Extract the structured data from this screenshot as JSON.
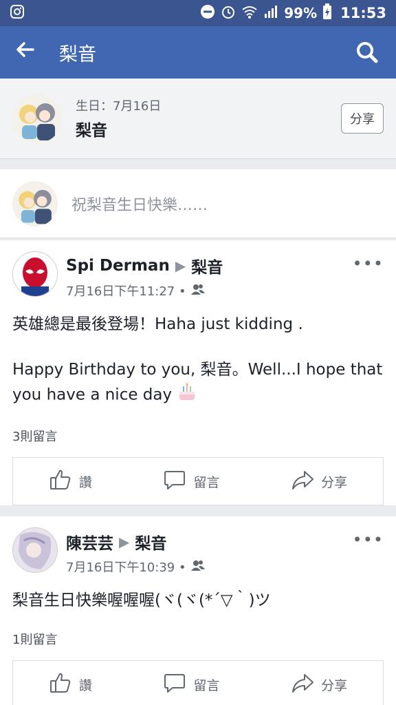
{
  "status": {
    "battery_pct": "99%",
    "time": "11:53"
  },
  "header": {
    "title": "梨音"
  },
  "profile": {
    "birthday": "生日：7月16日",
    "name": "梨音",
    "share_label": "分享"
  },
  "composer": {
    "placeholder": "祝梨音生日快樂……"
  },
  "posts": [
    {
      "author": "Spi Derman",
      "target": "梨音",
      "date": "7月16日下午11:27 •",
      "body": [
        "英雄總是最後登場！Haha just kidding .",
        "Happy Birthday to you, 梨音。Well...I hope that you have a nice day"
      ],
      "comments": "3則留言",
      "like": "讚",
      "comment": "留言",
      "share": "分享"
    },
    {
      "author": "陳芸芸",
      "target": "梨音",
      "date": "7月16日下午10:39 •",
      "body": [
        "梨音生日快樂喔喔喔(ヾ(ヾ(*´▽｀)ツ"
      ],
      "comments": "1則留言",
      "like": "讚",
      "comment": "留言",
      "share": "分享"
    }
  ]
}
